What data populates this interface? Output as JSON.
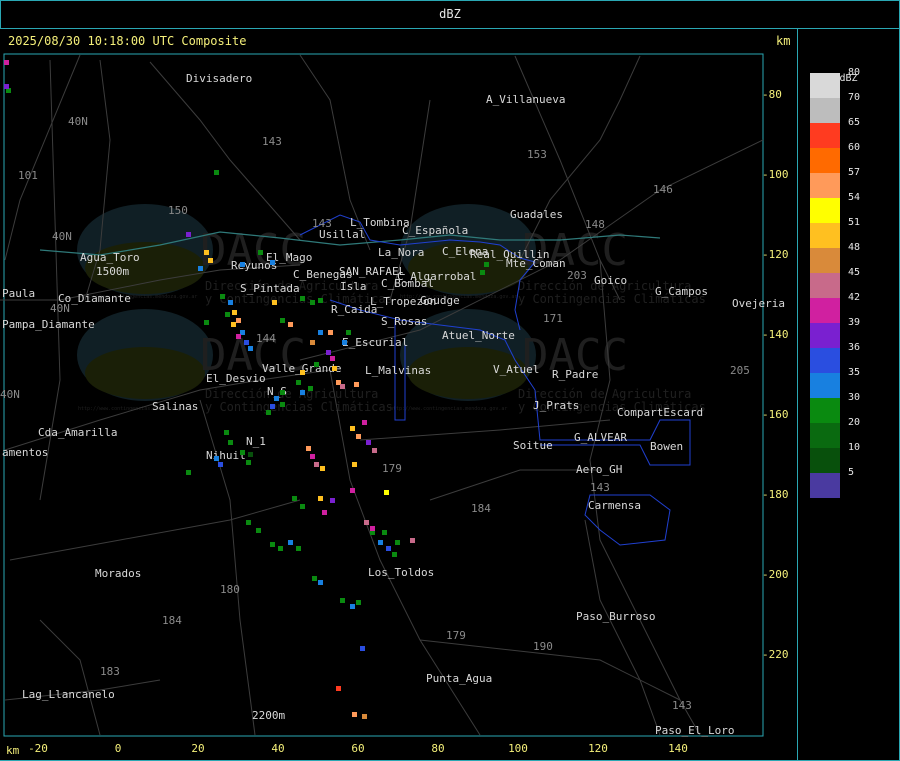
{
  "window": {
    "title": "dBZ"
  },
  "header": {
    "timestamp": "2025/08/30 10:18:00 UTC Composite",
    "unit_right": "km"
  },
  "axis": {
    "unit_left": "km",
    "x_ticks": [
      "-20",
      "0",
      "20",
      "40",
      "60",
      "80",
      "100",
      "120",
      "140"
    ],
    "y_ticks": [
      "-80",
      "-100",
      "-120",
      "-140",
      "-160",
      "-180",
      "-200",
      "-220"
    ]
  },
  "colorbar": {
    "title": "dBZ",
    "levels": [
      {
        "label": "80",
        "color": "#d9d9d9"
      },
      {
        "label": "70",
        "color": "#bdbdbd"
      },
      {
        "label": "65",
        "color": "#ff3b20"
      },
      {
        "label": "60",
        "color": "#ff6a00"
      },
      {
        "label": "57",
        "color": "#ff9a5a"
      },
      {
        "label": "54",
        "color": "#ffff00"
      },
      {
        "label": "51",
        "color": "#ffc020"
      },
      {
        "label": "48",
        "color": "#d98a3a"
      },
      {
        "label": "45",
        "color": "#c86a8a"
      },
      {
        "label": "42",
        "color": "#d020a0"
      },
      {
        "label": "39",
        "color": "#7a20d0"
      },
      {
        "label": "36",
        "color": "#2a4ee0"
      },
      {
        "label": "35",
        "color": "#1880e0"
      },
      {
        "label": "30",
        "color": "#0a8a10"
      },
      {
        "label": "20",
        "color": "#0a6a10"
      },
      {
        "label": "10",
        "color": "#08500c"
      },
      {
        "label": "5",
        "color": "#4a3aa0"
      }
    ]
  },
  "watermark": {
    "brand": "DACC",
    "line1": "Dirección de Agricultura",
    "line2": "y Contingencias Climáticas",
    "url": "http://www.contingencias.mendoza.gov.ar"
  },
  "places": [
    "Divisadero",
    "A_Villanueva",
    "Agua_Toro",
    "1500m",
    "Paula",
    "Pampa_Diamante",
    "Co_Diamante",
    "Reyunos",
    "El_Mago",
    "S_Pintada",
    "Usillal",
    "L_Tombina",
    "C_Española",
    "La_Nora",
    "C_Elena",
    "Guadales",
    "Real_Quillin",
    "Mte_Coman",
    "C_Benegas",
    "SAN_RAFAEL",
    "C_Algarrobal",
    "C_Bombal",
    "Isla",
    "L_Tropezon",
    "Goudge",
    "Goico",
    "G_Campos",
    "Ovejeria",
    "R_Caida",
    "S_Rosas",
    "Atuel_Norte",
    "E_Escurial",
    "Valle_Grande",
    "L_Malvinas",
    "El_Desvio",
    "V_Atuel",
    "R_Padre",
    "Salinas",
    "J_Prats",
    "CompartEscard",
    "N_S",
    "Cda_Amarilla",
    "N_1",
    "G_ALVEAR",
    "Bowen",
    "Soitue",
    "amentos",
    "Nihuil",
    "Aero_GH",
    "Carmensa",
    "Morados",
    "Los_Toldos",
    "Paso_Burroso",
    "Lag_Llancanelo",
    "Punta_Agua",
    "2200m",
    "Paso_El_Loro"
  ],
  "road_numbers": [
    "143",
    "153",
    "146",
    "101",
    "150",
    "148",
    "203",
    "171",
    "144",
    "184",
    "179",
    "180",
    "184",
    "183",
    "143",
    "190",
    "179",
    "205",
    "143",
    "143",
    "40N",
    "40N",
    "40N",
    "40N"
  ]
}
